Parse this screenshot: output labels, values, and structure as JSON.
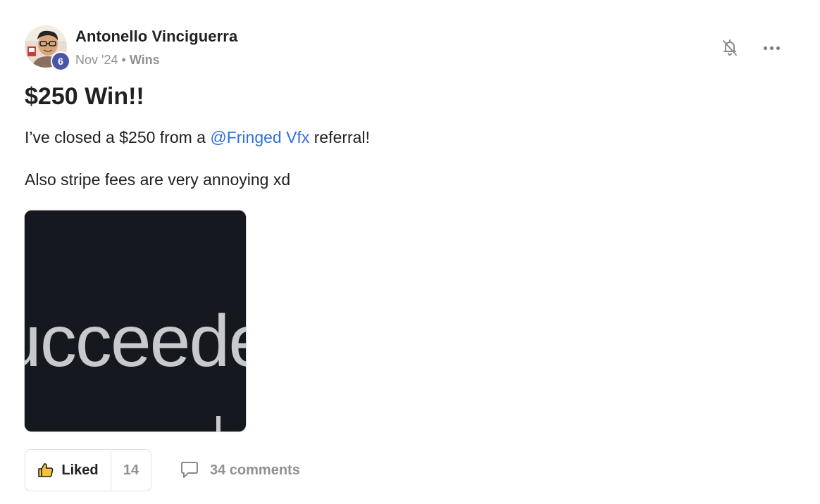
{
  "author": {
    "name": "Antonello Vinciguerra",
    "level": "6"
  },
  "meta": {
    "date": "Nov '24",
    "separator": "•",
    "category": "Wins"
  },
  "post": {
    "title": "$250 Win!!",
    "line1_before": "I’ve closed a $250 from a ",
    "mention": "@Fringed Vfx",
    "line1_after": " referral!",
    "line2": "Also stripe fees are very annoying xd",
    "attachment_text": "ucceeded"
  },
  "actions": {
    "like_label": "Liked",
    "like_count": "14",
    "comments_label": "34 comments"
  },
  "icons": {
    "bell": "bell-off-icon",
    "more": "more-horizontal-icon",
    "like": "thumbs-up-icon",
    "comment": "comment-bubble-icon"
  },
  "colors": {
    "mention": "#2e6fe0",
    "level_badge": "#4a55a8",
    "like_icon": "#f5c33b"
  }
}
